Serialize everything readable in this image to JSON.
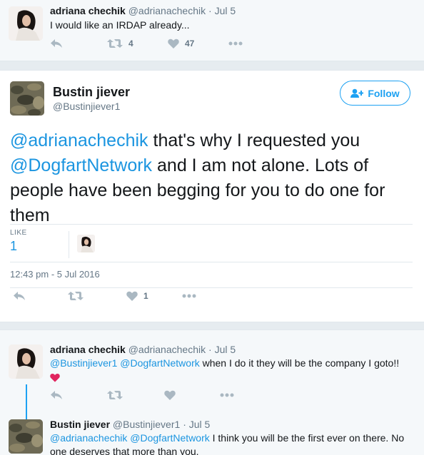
{
  "top_reply": {
    "name": "adriana chechik",
    "handle": "@adrianachechik",
    "sep": "·",
    "time": "Jul 5",
    "text": "I would like an IRDAP already...",
    "retweet_count": "4",
    "like_count": "47"
  },
  "main_tweet": {
    "name": "Bustin jiever",
    "handle": "@Bustinjiever1",
    "follow_label": "Follow",
    "mention1": "@adrianachechik",
    "text1": " that's why I requested you ",
    "mention2": "@DogfartNetwork",
    "text2": " and I am not alone. Lots of people have been begging for you to do one for them",
    "like_label": "LIKE",
    "like_count": "1",
    "timestamp": "12:43 pm - 5 Jul 2016",
    "action_like_count": "1"
  },
  "replies": [
    {
      "name": "adriana chechik",
      "handle": "@adrianachechik",
      "sep": "·",
      "time": "Jul 5",
      "mention1": "@Bustinjiever1",
      "mention2": "@DogfartNetwork",
      "text": " when I do it they will be the company I goto!!"
    },
    {
      "name": "Bustin jiever",
      "handle": "@Bustinjiever1",
      "sep": "·",
      "time": "Jul 5",
      "mention1": "@adrianachechik",
      "mention2": "@DogfartNetwork",
      "text": " I think you will be the first ever on there. No one deserves that more than you."
    }
  ],
  "icons": {
    "reply": "reply-icon",
    "retweet": "retweet-icon",
    "like": "heart-icon",
    "more": "more-icon",
    "follow": "add-user-icon",
    "emoji": "red-heart-emoji"
  },
  "colors": {
    "link": "#1b95e0",
    "accent": "#1da1f2",
    "muted": "#657786",
    "icon": "#aab8c2",
    "heart_emoji": "#e0245e"
  }
}
